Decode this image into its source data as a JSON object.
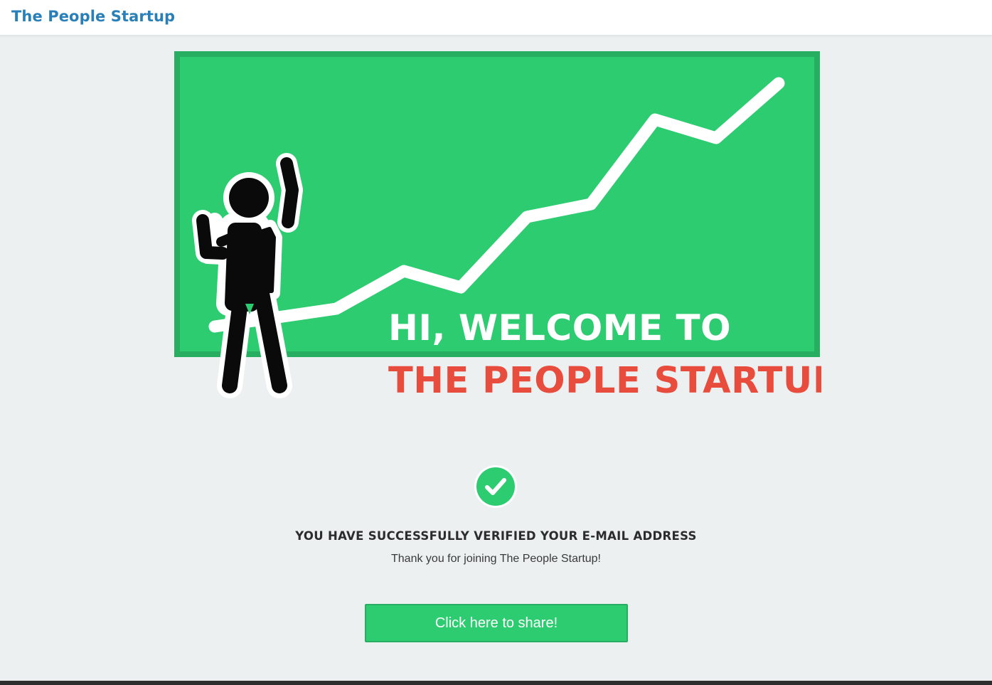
{
  "navbar": {
    "brand": "The People Startup"
  },
  "hero": {
    "welcome_line": "HI, WELCOME TO",
    "brand_line": "THE PEOPLE STARTUP",
    "colors": {
      "board": "#2ecc71",
      "board_border": "#27ae60",
      "brand_text": "#e74c3c",
      "figure": "#0a0a0a"
    }
  },
  "status": {
    "icon": "checkmark-circle-icon",
    "title": "YOU HAVE SUCCESSFULLY VERIFIED YOUR E-MAIL ADDRESS",
    "subtitle": "Thank you for joining The People Startup!"
  },
  "share": {
    "label": "Click here to share!"
  },
  "colors": {
    "accent": "#2ecc71",
    "accent_border": "#27ae60",
    "brand_link": "#2980b9",
    "page_bg": "#ecf0f1"
  }
}
